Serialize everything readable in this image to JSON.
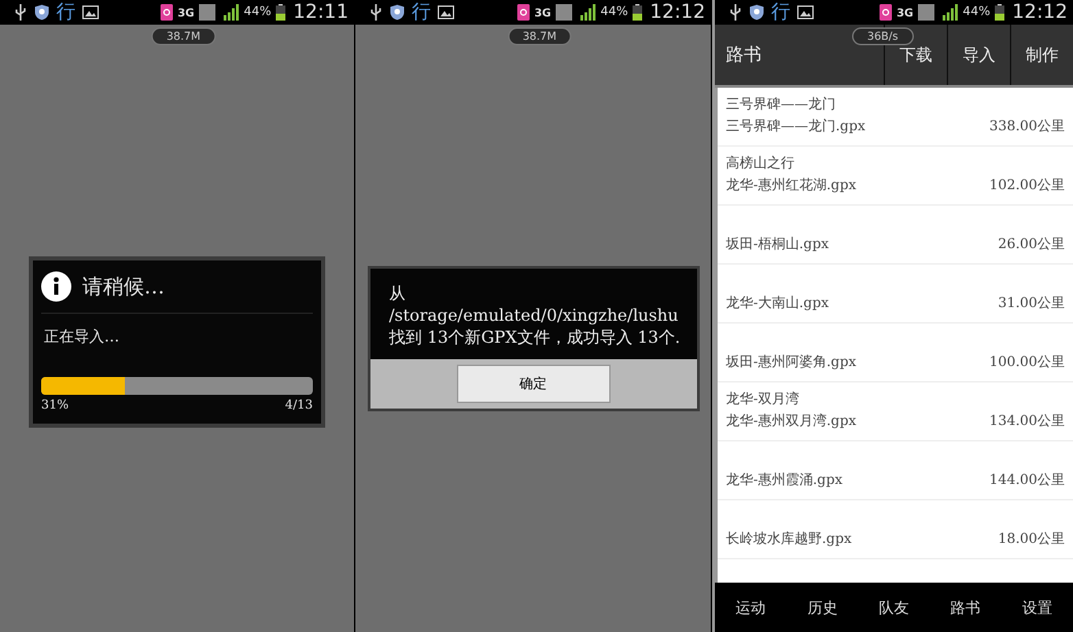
{
  "screens": [
    {
      "kind": "progress",
      "status_bar": {
        "app_glyph": "行",
        "network": "3G",
        "battery": "44%",
        "time": "12:11"
      },
      "chip": "38.7M",
      "dialog": {
        "title": "请稍候…",
        "message": "正在导入…",
        "level": 0.31,
        "percent": "31%",
        "count": "4/13"
      }
    },
    {
      "kind": "alert",
      "status_bar": {
        "app_glyph": "行",
        "network": "3G",
        "battery": "44%",
        "time": "12:12"
      },
      "chip": "38.7M",
      "dialog": {
        "message": "从 /storage/emulated/0/xingzhe/lushu 找到 13个新GPX文件，成功导入 13个.",
        "button": "确定"
      }
    },
    {
      "kind": "list",
      "status_bar": {
        "app_glyph": "行",
        "network": "3G",
        "battery": "44%",
        "time": "12:12"
      },
      "chip": "36B/s",
      "header": {
        "title": "路书",
        "actions": [
          "下载",
          "导入",
          "制作"
        ]
      },
      "items": [
        {
          "title": "三号界碑——龙门",
          "file": "三号界碑——龙门.gpx",
          "distance": "338.00公里"
        },
        {
          "title": "高榜山之行",
          "file": "龙华-惠州红花湖.gpx",
          "distance": "102.00公里"
        },
        {
          "file": "坂田-梧桐山.gpx",
          "distance": "26.00公里"
        },
        {
          "file": "龙华-大南山.gpx",
          "distance": "31.00公里"
        },
        {
          "file": "坂田-惠州阿婆角.gpx",
          "distance": "100.00公里"
        },
        {
          "title": "龙华-双月湾",
          "file": "龙华-惠州双月湾.gpx",
          "distance": "134.00公里"
        },
        {
          "file": "龙华-惠州霞涌.gpx",
          "distance": "144.00公里"
        },
        {
          "file": "长岭坡水库越野.gpx",
          "distance": "18.00公里"
        }
      ],
      "tabs": [
        "运动",
        "历史",
        "队友",
        "路书",
        "设置"
      ]
    }
  ]
}
